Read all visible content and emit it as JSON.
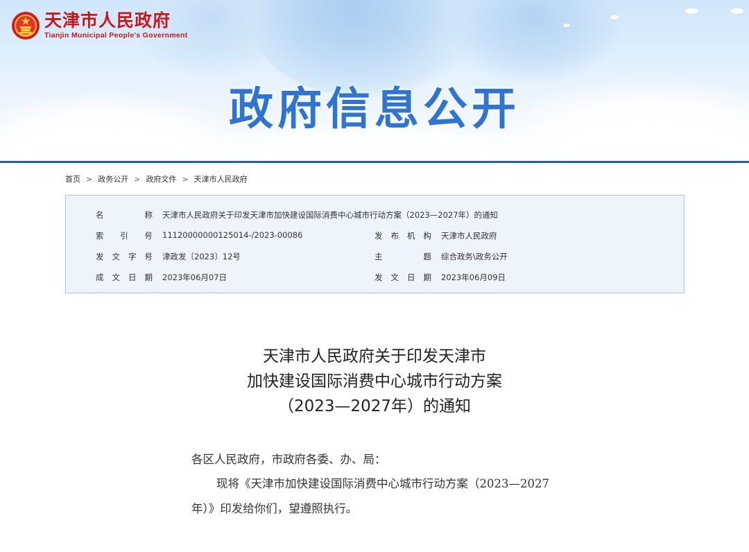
{
  "header": {
    "logo_cn": "天津市人民政府",
    "logo_en": "Tianjin Municipal People's Government",
    "banner_title": "政府信息公开",
    "colors": {
      "logo_red": "#c8161d",
      "banner_blue": "#2f75cf",
      "rule_blue": "#1e5fb6"
    }
  },
  "breadcrumb": {
    "items": [
      "首页",
      "政务公开",
      "政府文件",
      "天津市人民政府"
    ],
    "separator": ">"
  },
  "info": {
    "colon": "：",
    "name": {
      "label": "名称",
      "value": "天津市人民政府关于印发天津市加快建设国际消费中心城市行动方案（2023—2027年）的通知"
    },
    "index_no": {
      "label": "索引号",
      "value": "11120000000125014-/2023-00086"
    },
    "publisher": {
      "label": "发布机构",
      "value": "天津市人民政府"
    },
    "doc_no": {
      "label": "发文字号",
      "value": "津政发〔2023〕12号"
    },
    "topic": {
      "label": "主题",
      "value": "综合政务\\政务公开"
    },
    "created": {
      "label": "成文日期",
      "value": "2023年06月07日"
    },
    "published": {
      "label": "发文日期",
      "value": "2023年06月09日"
    }
  },
  "document": {
    "title_lines": [
      "天津市人民政府关于印发天津市",
      "加快建设国际消费中心城市行动方案",
      "（2023—2027年）的通知"
    ],
    "salutation": "各区人民政府，市政府各委、办、局：",
    "body": "现将《天津市加快建设国际消费中心城市行动方案（2023—2027年）》印发给你们，望遵照执行。"
  }
}
